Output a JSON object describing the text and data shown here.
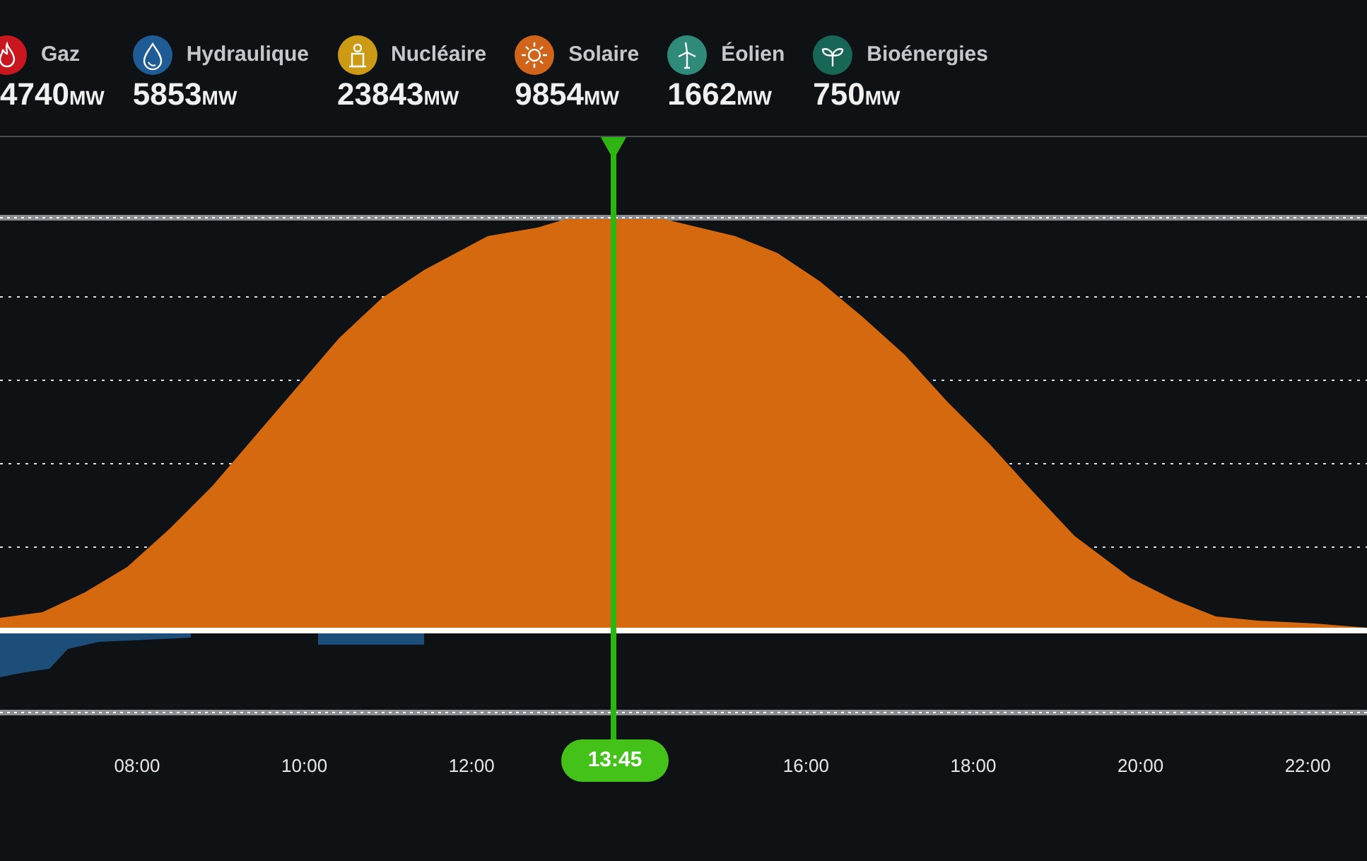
{
  "legend": [
    {
      "kind": "gas",
      "label": "Gaz",
      "value": "4740",
      "unit": "MW",
      "color": "#c8171e"
    },
    {
      "kind": "hydro",
      "label": "Hydraulique",
      "value": "5853",
      "unit": "MW",
      "color": "#1f5c96"
    },
    {
      "kind": "nuclear",
      "label": "Nucléaire",
      "value": "23843",
      "unit": "MW",
      "color": "#cc9a14"
    },
    {
      "kind": "solar",
      "label": "Solaire",
      "value": "9854",
      "unit": "MW",
      "color": "#d0641a"
    },
    {
      "kind": "wind",
      "label": "Éolien",
      "value": "1662",
      "unit": "MW",
      "color": "#2f8a7a"
    },
    {
      "kind": "bio",
      "label": "Bioénergies",
      "value": "750",
      "unit": "MW",
      "color": "#176656"
    }
  ],
  "chart": {
    "cursor_time": "13:45",
    "time_labels": [
      "08:00",
      "10:00",
      "12:00",
      "16:00",
      "18:00",
      "20:00",
      "22:00"
    ]
  }
}
